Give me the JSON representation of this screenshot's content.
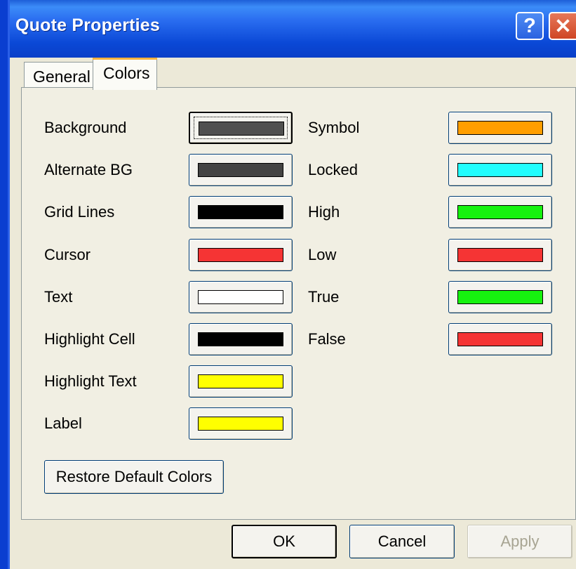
{
  "window": {
    "title": "Quote Properties",
    "help_glyph": "?",
    "close_glyph": "✕"
  },
  "tabs": [
    {
      "label": "General",
      "selected": false
    },
    {
      "label": "Colors",
      "selected": true
    }
  ],
  "colors_left": [
    {
      "label": "Background",
      "color": "#505050"
    },
    {
      "label": "Alternate BG",
      "color": "#434343"
    },
    {
      "label": "Grid Lines",
      "color": "#000000"
    },
    {
      "label": "Cursor",
      "color": "#f53434"
    },
    {
      "label": "Text",
      "color": "#ffffff"
    },
    {
      "label": "Highlight Cell",
      "color": "#000000"
    },
    {
      "label": "Highlight Text",
      "color": "#ffff00"
    },
    {
      "label": "Label",
      "color": "#ffff00"
    }
  ],
  "colors_right": [
    {
      "label": "Symbol",
      "color": "#ff9e00"
    },
    {
      "label": "Locked",
      "color": "#22fdfd"
    },
    {
      "label": "High",
      "color": "#16f20f"
    },
    {
      "label": "Low",
      "color": "#f53434"
    },
    {
      "label": "True",
      "color": "#16f20f"
    },
    {
      "label": "False",
      "color": "#f53434"
    }
  ],
  "restore_label": "Restore Default Colors",
  "footer": {
    "ok_label": "OK",
    "cancel_label": "Cancel",
    "apply_label": "Apply"
  }
}
